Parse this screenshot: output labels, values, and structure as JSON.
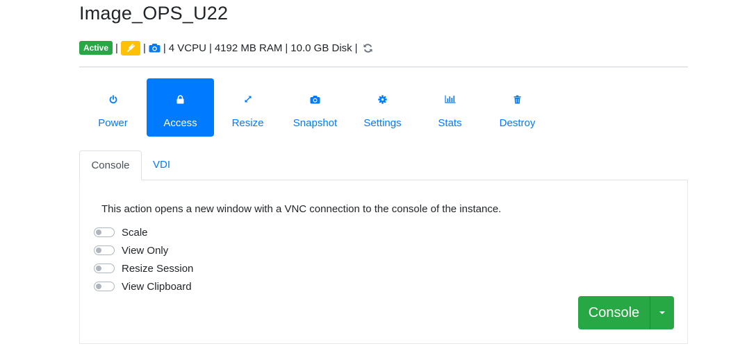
{
  "instance": {
    "name": "Image_OPS_U22",
    "status": "Active",
    "specs": {
      "vcpu": "4 VCPU",
      "ram": "4192 MB RAM",
      "disk": "10.0 GB Disk"
    },
    "separator": "|"
  },
  "actions": [
    {
      "label": "Power",
      "icon": "power-icon",
      "active": false
    },
    {
      "label": "Access",
      "icon": "lock-icon",
      "active": true
    },
    {
      "label": "Resize",
      "icon": "resize-arrows-icon",
      "active": false
    },
    {
      "label": "Snapshot",
      "icon": "camera-icon",
      "active": false
    },
    {
      "label": "Settings",
      "icon": "gear-icon",
      "active": false
    },
    {
      "label": "Stats",
      "icon": "bar-chart-icon",
      "active": false
    },
    {
      "label": "Destroy",
      "icon": "trash-icon",
      "active": false
    }
  ],
  "tabs": [
    {
      "label": "Console",
      "active": true
    },
    {
      "label": "VDI",
      "active": false
    }
  ],
  "console_panel": {
    "description": "This action opens a new window with a VNC connection to the console of the instance.",
    "options": [
      {
        "label": "Scale",
        "enabled": false
      },
      {
        "label": "View Only",
        "enabled": false
      },
      {
        "label": "Resize Session",
        "enabled": false
      },
      {
        "label": "View Clipboard",
        "enabled": false
      }
    ],
    "button_label": "Console"
  },
  "colors": {
    "primary": "#007bff",
    "success": "#28a745",
    "warning": "#ffc107"
  }
}
